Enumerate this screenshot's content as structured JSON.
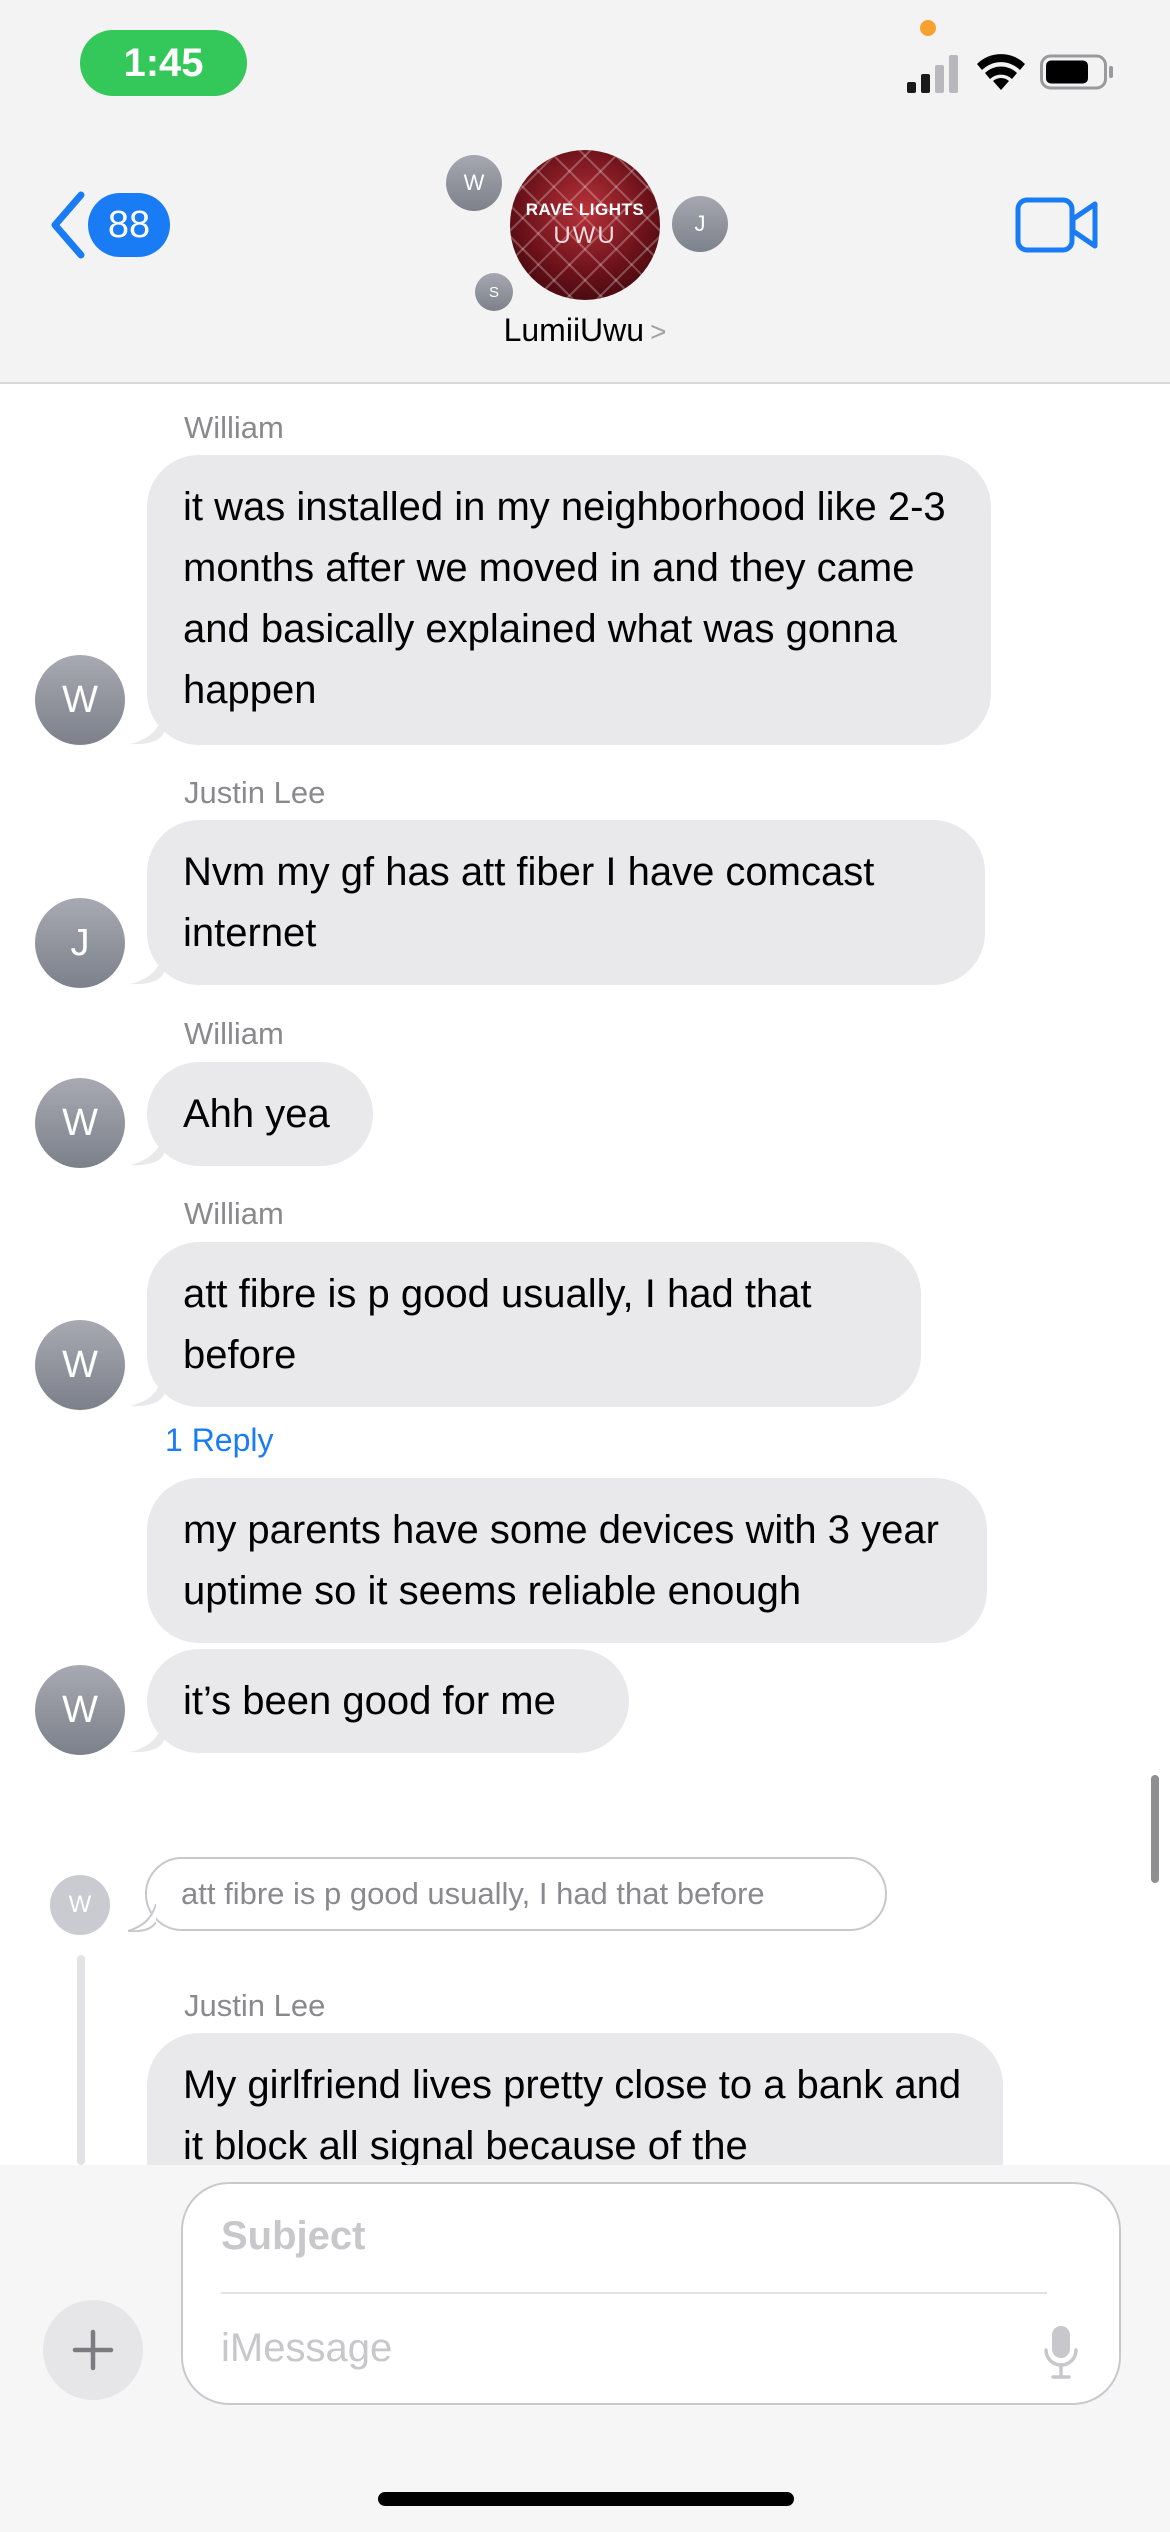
{
  "status_bar": {
    "time": "1:45"
  },
  "header": {
    "back_count": "88",
    "group_name": "LumiiUwu",
    "group_avatar_line1": "RAVE LIGHTS",
    "group_avatar_line2": "UWU",
    "member_initials": [
      "W",
      "J",
      "S"
    ]
  },
  "messages": [
    {
      "sender": "William",
      "initial": "W",
      "text": "it was installed in my neighborhood like 2-3 months after we moved in and they came and basically explained what was gonna happen"
    },
    {
      "sender": "Justin Lee",
      "initial": "J",
      "text": "Nvm my gf has att fiber I have comcast internet"
    },
    {
      "sender": "William",
      "initial": "W",
      "text": "Ahh yea"
    },
    {
      "sender": "William",
      "initial": "W",
      "text": "att fibre is p good usually, I had that before",
      "reply_label": "1 Reply"
    },
    {
      "sender": "",
      "initial": "",
      "text": "my parents have some devices with 3 year uptime so it seems reliable enough"
    },
    {
      "sender": "",
      "initial": "W",
      "text": "it’s been good for me"
    }
  ],
  "thread": {
    "quote_initial": "W",
    "quote_text": "att fibre is p good usually, I had that before",
    "sender": "Justin Lee",
    "text": "My girlfriend lives pretty close to a bank and it block all signal because of the"
  },
  "composer": {
    "subject_placeholder": "Subject",
    "message_placeholder": "iMessage"
  },
  "colors": {
    "accent": "#1a7cf5",
    "bubble_gray": "#e9e9eb",
    "time_pill_green": "#34c759"
  },
  "icons": [
    "back-chevron-icon",
    "video-camera-icon",
    "plus-icon",
    "microphone-icon",
    "signal-icon",
    "wifi-icon",
    "battery-icon"
  ]
}
